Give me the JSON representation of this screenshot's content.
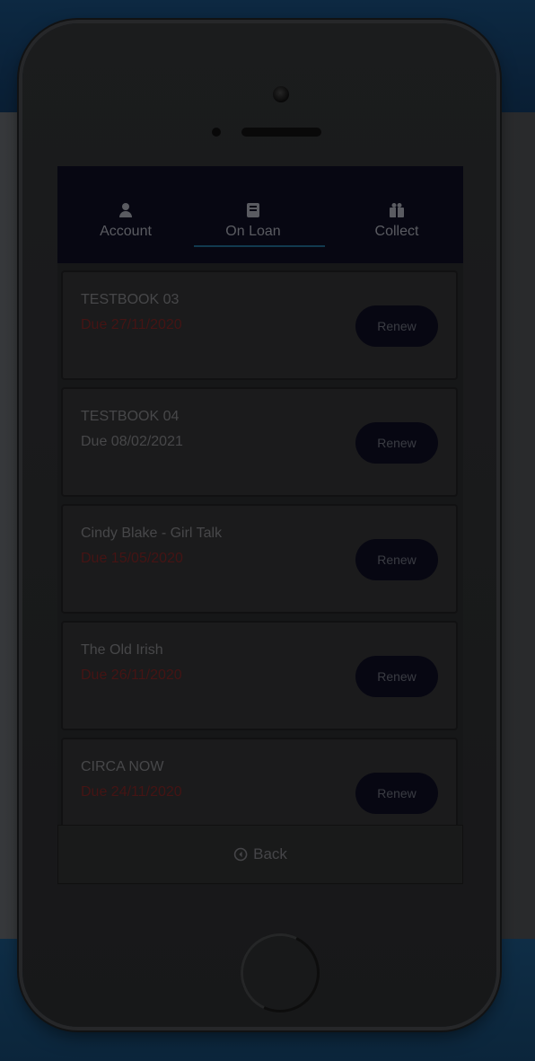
{
  "tabs": [
    {
      "label": "Account",
      "icon": "person-icon"
    },
    {
      "label": "On Loan",
      "icon": "book-icon"
    },
    {
      "label": "Collect",
      "icon": "gift-icon"
    }
  ],
  "active_tab": "On Loan",
  "loans": [
    {
      "title": "TESTBOOK 03",
      "due": "Due 27/11/2020",
      "overdue": true,
      "renew_label": "Renew"
    },
    {
      "title": "TESTBOOK 04",
      "due": "Due 08/02/2021",
      "overdue": false,
      "renew_label": "Renew"
    },
    {
      "title": "Cindy Blake - Girl Talk",
      "due": "Due 15/05/2020",
      "overdue": true,
      "renew_label": "Renew"
    },
    {
      "title": "The Old Irish",
      "due": "Due 26/11/2020",
      "overdue": true,
      "renew_label": "Renew"
    },
    {
      "title": "CIRCA NOW",
      "due": "Due 24/11/2020",
      "overdue": true,
      "renew_label": "Renew"
    }
  ],
  "back": {
    "label": "Back",
    "icon": "back-circle-icon"
  },
  "colors": {
    "tabbar_bg": "#0b0b1c",
    "overdue_text": "#6a1f1f",
    "accent_underline": "#1d5a7a"
  }
}
